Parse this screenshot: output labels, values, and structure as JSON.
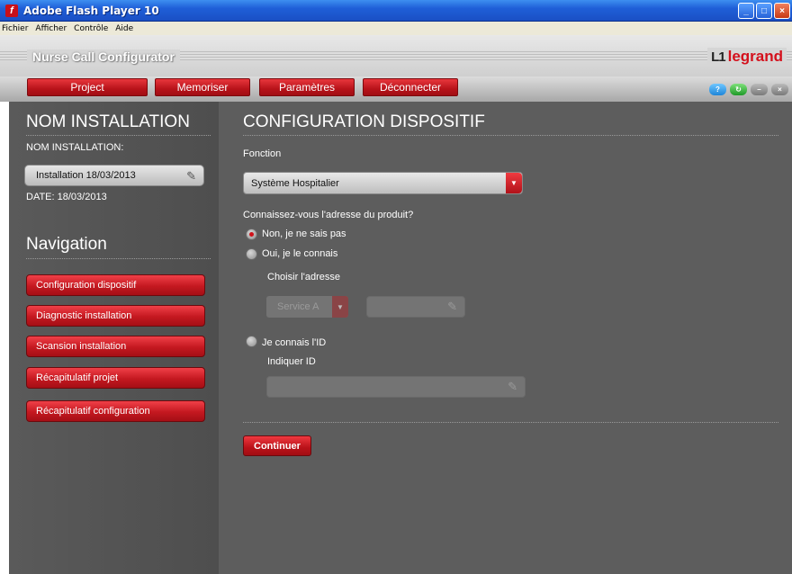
{
  "window": {
    "title": "Adobe Flash Player 10"
  },
  "menubar": {
    "items": [
      "Fichier",
      "Afficher",
      "Contrôle",
      "Aide"
    ]
  },
  "app": {
    "title": "Nurse Call Configurator",
    "logo_text": "legrand"
  },
  "topnav": {
    "project": "Project",
    "memoriser": "Memoriser",
    "parametres": "Paramètres",
    "deconnecter": "Déconnecter"
  },
  "left": {
    "heading": "NOM INSTALLATION",
    "name_label": "NOM INSTALLATION:",
    "name_value": "Installation  18/03/2013",
    "date_label": "DATE: 18/03/2013",
    "nav_heading": "Navigation",
    "nav_items": [
      "Configuration dispositif",
      "Diagnostic installation",
      "Scansion installation",
      "Récapitulatif projet",
      "Récapitulatif configuration"
    ]
  },
  "main": {
    "heading": "CONFIGURATION DISPOSITIF",
    "fonction_label": "Fonction",
    "fonction_value": "Système Hospitalier",
    "question": "Connaissez-vous l'adresse du produit?",
    "option_no": "Non, je ne sais pas",
    "option_yes": "Oui, je le connais",
    "choose_address": "Choisir l'adresse",
    "service_value": "Service A",
    "option_id": "Je connais l'ID",
    "indicate_id": "Indiquer ID",
    "continue_label": "Continuer"
  },
  "colors": {
    "accent_red": "#c41820",
    "panel_grey": "#5d5d5d",
    "titlebar_blue": "#1f5fd8"
  }
}
